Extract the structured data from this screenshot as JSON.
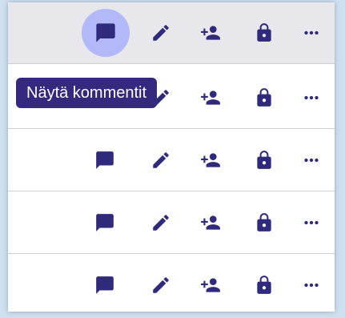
{
  "tooltip": {
    "text": "Näytä kommentit"
  },
  "rows": [
    {
      "icons": [
        "comment-icon",
        "edit-icon",
        "add-user-icon",
        "lock-icon",
        "more-icon"
      ],
      "hovered": true
    },
    {
      "icons": [
        "comment-icon",
        "edit-icon",
        "add-user-icon",
        "lock-icon",
        "more-icon"
      ]
    },
    {
      "icons": [
        "comment-icon",
        "edit-icon",
        "add-user-icon",
        "lock-icon",
        "more-icon"
      ]
    },
    {
      "icons": [
        "comment-icon",
        "edit-icon",
        "add-user-icon",
        "lock-icon",
        "more-icon"
      ]
    },
    {
      "icons": [
        "comment-icon",
        "edit-icon",
        "add-user-icon",
        "lock-icon",
        "more-icon"
      ]
    }
  ],
  "colors": {
    "icon": "#2f2a7c",
    "hover_circle": "#b3b8f8",
    "tooltip_bg": "#332a80",
    "row_hover_bg": "#e8e8ec",
    "background": "#cfe0f1"
  }
}
